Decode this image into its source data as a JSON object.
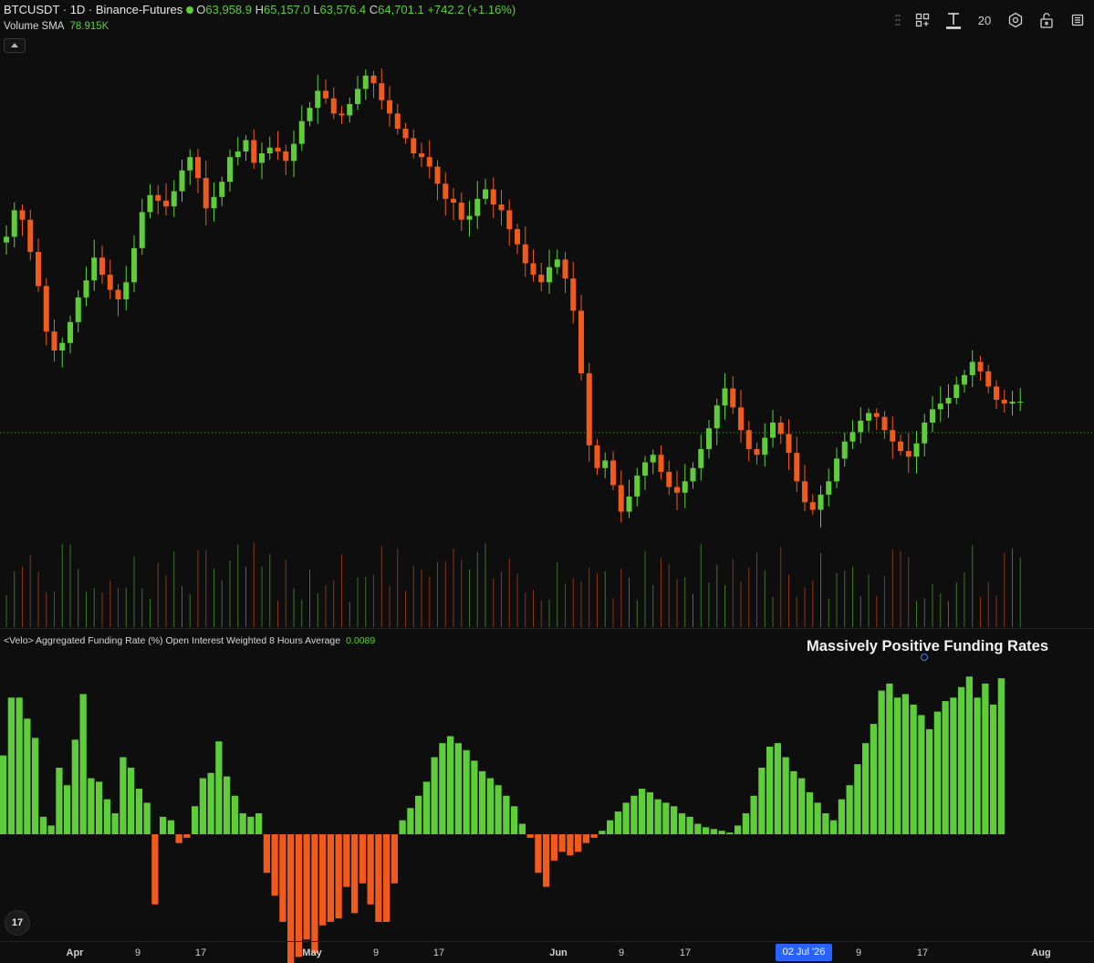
{
  "header": {
    "symbol": "BTCUSDT · 1D · Binance-Futures",
    "open_label": "O",
    "open": "63,958.9",
    "high_label": "H",
    "high": "65,157.0",
    "low_label": "L",
    "low": "63,576.4",
    "close_label": "C",
    "close": "64,701.1",
    "change": "+742.2 (+1.16%)",
    "volume_label": "Volume SMA",
    "volume_value": "78.915K"
  },
  "toolbar": {
    "interval": "20"
  },
  "icons": [
    "grid-plus-icon",
    "text-icon",
    "hexagon-settings-icon",
    "unlock-icon",
    "more-icon"
  ],
  "funding_panel": {
    "title": "<Velo> Aggregated Funding Rate (%) Open Interest Weighted 8 Hours Average",
    "value": "0.0089",
    "annotation": "Massively Positive Funding Rates"
  },
  "x_axis": {
    "labels": [
      {
        "text": "Apr",
        "bold": true
      },
      {
        "text": "9",
        "bold": false
      },
      {
        "text": "17",
        "bold": false
      },
      {
        "text": "May",
        "bold": true
      },
      {
        "text": "9",
        "bold": false
      },
      {
        "text": "17",
        "bold": false
      },
      {
        "text": "Jun",
        "bold": true
      },
      {
        "text": "9",
        "bold": false
      },
      {
        "text": "17",
        "bold": false
      },
      {
        "text": "9",
        "bold": false
      },
      {
        "text": "17",
        "bold": false
      },
      {
        "text": "Aug",
        "bold": true
      }
    ],
    "crosshair_date": "02 Jul '26"
  },
  "colors": {
    "up": "#5fcd3a",
    "down": "#f05a1c",
    "background": "#0e0e0f"
  },
  "chart_data": [
    {
      "type": "candlestick",
      "series": "price",
      "y_unit": "USDT",
      "bars": 161,
      "note_levels": {
        "close": 64701.1,
        "high_peak": 82000,
        "low_trough": 58200,
        "dotted_level": 64701.1
      },
      "closes": [
        73400,
        74800,
        74300,
        72600,
        70800,
        68400,
        67400,
        67800,
        68900,
        70200,
        71100,
        72300,
        71400,
        70600,
        70100,
        71000,
        72800,
        74700,
        75600,
        75300,
        75000,
        75800,
        76900,
        77600,
        76500,
        74900,
        75500,
        76300,
        77600,
        77900,
        78500,
        77300,
        77800,
        78100,
        77900,
        77400,
        78300,
        79500,
        80200,
        81100,
        80700,
        79900,
        79800,
        80400,
        81200,
        81900,
        81500,
        80600,
        79900,
        79100,
        78600,
        77800,
        77600,
        77100,
        76200,
        75400,
        75200,
        74300,
        74500,
        75400,
        75900,
        75100,
        74800,
        73800,
        73000,
        72000,
        71400,
        71000,
        71800,
        72200,
        71200,
        69500,
        66200,
        62400,
        61200,
        61600,
        60300,
        58900,
        59700,
        60800,
        61500,
        61900,
        61000,
        60200,
        59900,
        60500,
        61200,
        62200,
        63300,
        64500,
        65400,
        64400,
        63200,
        62200,
        61900,
        62800,
        63600,
        63000,
        62000,
        60500,
        59400,
        59000,
        59800,
        60500,
        61700,
        62600,
        63100,
        63700,
        64100,
        63900,
        63200,
        62600,
        62100,
        61800,
        62500,
        63600,
        64300,
        64600,
        64900,
        65600,
        66100,
        66800,
        66300,
        65500,
        64800,
        64600,
        64700,
        64701.1
      ]
    },
    {
      "type": "bar",
      "series": "funding_rate",
      "y_unit": "%",
      "values": [
        0.0045,
        0.0078,
        0.0078,
        0.0066,
        0.0055,
        0.001,
        0.0005,
        0.0038,
        0.0028,
        0.0054,
        0.008,
        0.0032,
        0.003,
        0.002,
        0.0012,
        0.0044,
        0.0038,
        0.0026,
        0.0018,
        -0.004,
        0.001,
        0.0008,
        -0.0005,
        -0.0002,
        0.0016,
        0.0032,
        0.0035,
        0.0053,
        0.0033,
        0.0022,
        0.0012,
        0.001,
        0.0012,
        -0.0022,
        -0.0035,
        -0.005,
        -0.0075,
        -0.007,
        -0.006,
        -0.0068,
        -0.0052,
        -0.005,
        -0.0048,
        -0.003,
        -0.0045,
        -0.0028,
        -0.004,
        -0.005,
        -0.005,
        -0.0028,
        0.0008,
        0.0015,
        0.0022,
        0.003,
        0.0044,
        0.0052,
        0.0056,
        0.0052,
        0.0048,
        0.0042,
        0.0036,
        0.0032,
        0.0028,
        0.0022,
        0.0016,
        0.0006,
        -0.0002,
        -0.0022,
        -0.003,
        -0.0015,
        -0.001,
        -0.0012,
        -0.001,
        -0.0005,
        -0.0002,
        0.0002,
        0.0008,
        0.0013,
        0.0018,
        0.0022,
        0.0026,
        0.0024,
        0.002,
        0.0018,
        0.0016,
        0.0012,
        0.001,
        0.0006,
        0.0004,
        0.0003,
        0.0002,
        0.0001,
        0.0005,
        0.0012,
        0.0022,
        0.0038,
        0.005,
        0.0052,
        0.0044,
        0.0036,
        0.0032,
        0.0024,
        0.0018,
        0.0012,
        0.0008,
        0.002,
        0.0028,
        0.004,
        0.0052,
        0.0063,
        0.0082,
        0.0086,
        0.0078,
        0.008,
        0.0074,
        0.0068,
        0.006,
        0.007,
        0.0076,
        0.0078,
        0.0084,
        0.009,
        0.0078,
        0.0086,
        0.0074,
        0.0089
      ]
    }
  ]
}
